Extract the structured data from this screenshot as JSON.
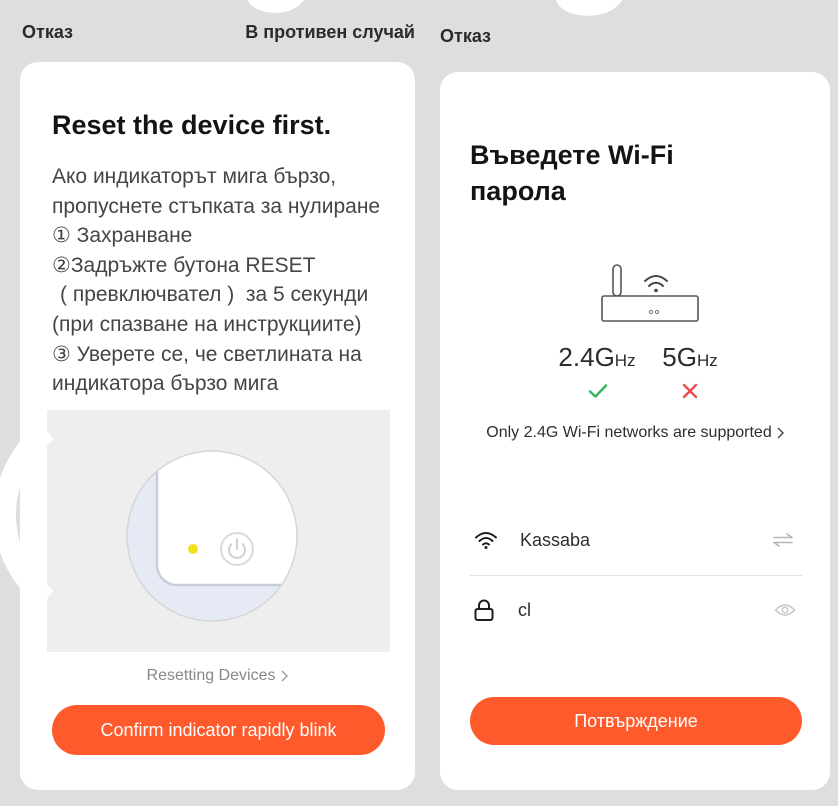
{
  "colors": {
    "background": "#dedede",
    "card": "#ffffff",
    "accent": "#fe5a2b",
    "success": "#34b35a",
    "error": "#f04a4a",
    "muted": "#888888"
  },
  "left": {
    "cancel_label": "Отказ",
    "otherwise_label": "В противен случай",
    "title": "Reset the device first.",
    "instructions": [
      "Ако индикаторът мига бързо,",
      "пропуснете стъпката за нулиране",
      "① Захранване",
      "②Задръжте бутона RESET",
      "( превключвател )  за 5 секунди",
      "(при спазване на инструкциите)",
      "③ Уверете се, че светлината на",
      "индикатора бързо мига"
    ],
    "illustration": {
      "indicator": "yellow-led-dot",
      "button_icon": "power-icon"
    },
    "resetting_link": "Resetting Devices",
    "resetting_link_icon": "chevron-right-icon",
    "confirm_button": "Confirm indicator rapidly blink"
  },
  "right": {
    "cancel_label": "Отказ",
    "title_lines": [
      "Въведете Wi-Fi",
      "парола"
    ],
    "router_icon": "router-icon",
    "bands": [
      {
        "label": "2.4G",
        "unit": "Hz",
        "supported": true,
        "status_icon": "check-icon"
      },
      {
        "label": "5G",
        "unit": "Hz",
        "supported": false,
        "status_icon": "close-icon"
      }
    ],
    "support_note": "Only 2.4G Wi-Fi networks are supported",
    "support_note_icon": "chevron-right-icon",
    "wifi_row": {
      "icon": "wifi-icon",
      "ssid": "Kassaba",
      "action_icon": "switch-network-icon"
    },
    "password_row": {
      "icon": "lock-icon",
      "value": "cl",
      "action_icon": "eye-icon"
    },
    "confirm_button": "Потвърждение"
  }
}
